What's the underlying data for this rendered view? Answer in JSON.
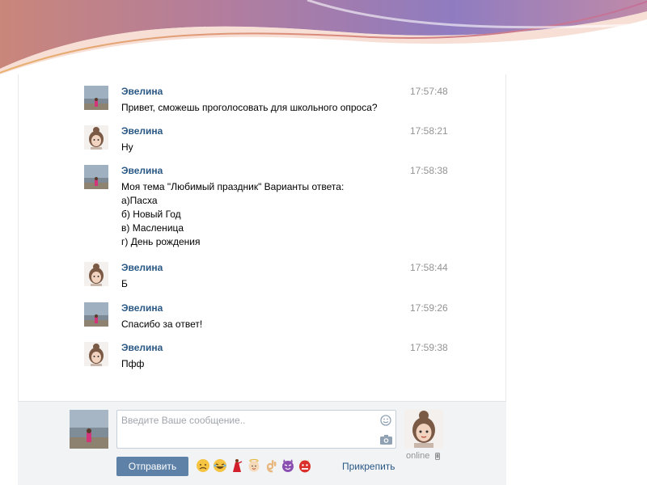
{
  "messages": [
    {
      "author": "Эвелина",
      "time": "17:57:48",
      "lines": [
        "Привет, сможешь проголосовать для школьного опроса?"
      ],
      "avatar": "beach-photo-avatar"
    },
    {
      "author": "Эвелина",
      "time": "17:58:21",
      "lines": [
        "Ну"
      ],
      "avatar": "cartoon-girl-avatar"
    },
    {
      "author": "Эвелина",
      "time": "17:58:38",
      "lines": [
        "Моя тема \"Любимый праздник\" Варианты ответа:",
        "а)Пасха",
        "б) Новый Год",
        "в) Масленица",
        "г) День рождения"
      ],
      "avatar": "beach-photo-avatar"
    },
    {
      "author": "Эвелина",
      "time": "17:58:44",
      "lines": [
        "Б"
      ],
      "avatar": "cartoon-girl-avatar"
    },
    {
      "author": "Эвелина",
      "time": "17:59:26",
      "lines": [
        "Спасибо за ответ!"
      ],
      "avatar": "beach-photo-avatar"
    },
    {
      "author": "Эвелина",
      "time": "17:59:38",
      "lines": [
        "Пфф"
      ],
      "avatar": "cartoon-girl-avatar"
    }
  ],
  "composer": {
    "placeholder": "Введите Ваше сообщение..",
    "send_label": "Отправить",
    "attach_label": "Прикрепить",
    "emojis": [
      "disappointed-face-emoji",
      "laughing-tears-emoji",
      "dancer-emoji",
      "angel-face-emoji",
      "ok-hand-emoji",
      "purple-devil-emoji",
      "red-ogre-emoji"
    ]
  },
  "friend": {
    "status": "online"
  },
  "colors": {
    "name_link": "#2a5885",
    "time": "#939393",
    "send_button": "#5e81a8",
    "composer_bg": "#f2f3f5"
  }
}
